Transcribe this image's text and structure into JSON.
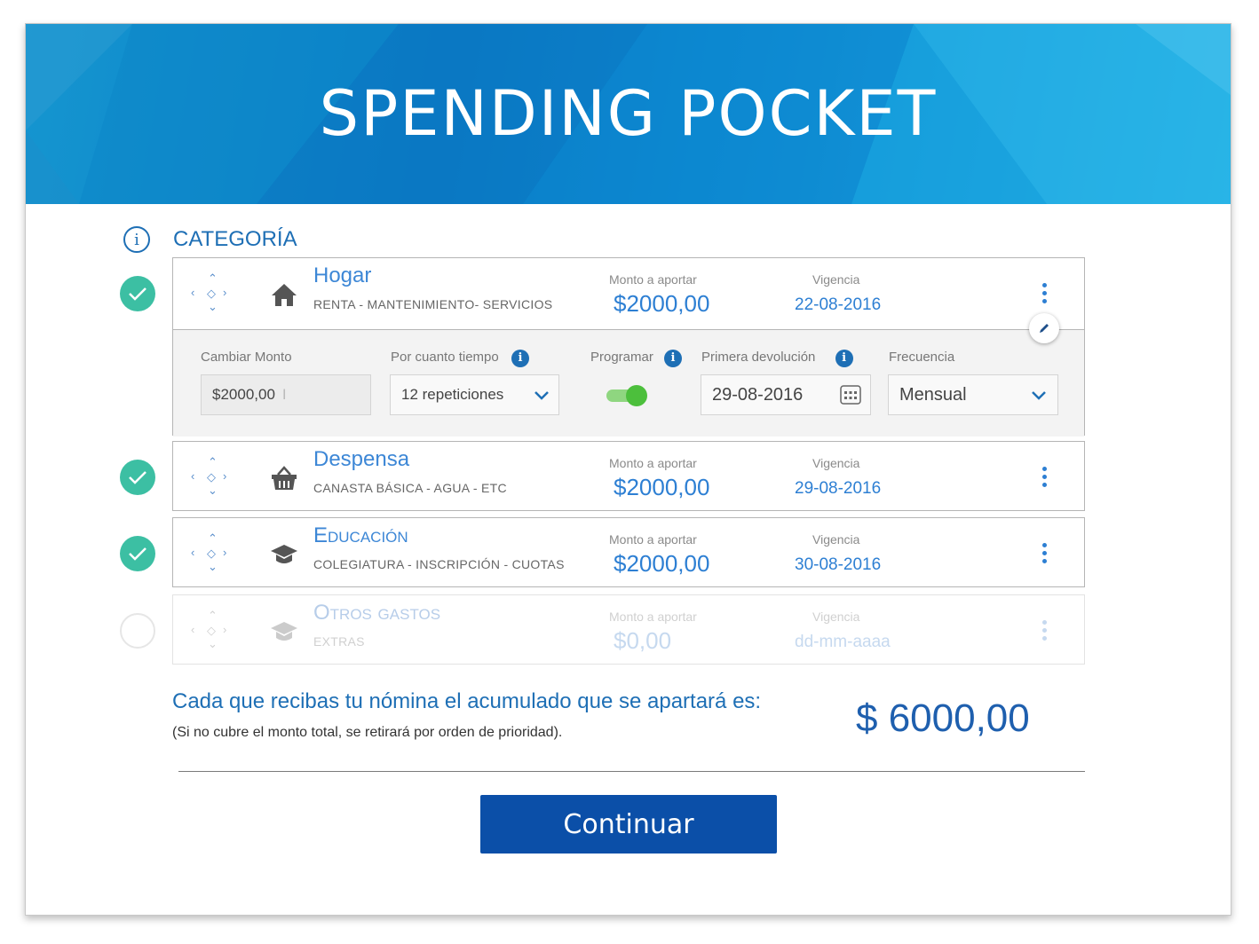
{
  "banner": {
    "title": "SPENDING POCKET"
  },
  "category_header": {
    "info_icon": "info-circle-icon",
    "title": "CATEGORÍA"
  },
  "categories": [
    {
      "title": "Hogar",
      "subtitle": "RENTA - MANTENIMIENTO- SERVICIOS",
      "icon": "house-icon",
      "amount_label": "Monto a aportar",
      "amount": "$2000,00",
      "validity_label": "Vigencia",
      "validity": "22-08-2016",
      "checked": true
    },
    {
      "title": "Despensa",
      "subtitle": "CANASTA BÁSICA - AGUA - ETC",
      "icon": "basket-icon",
      "amount_label": "Monto a aportar",
      "amount": "$2000,00",
      "validity_label": "Vigencia",
      "validity": "29-08-2016",
      "checked": true
    },
    {
      "title": "Educación",
      "subtitle": "COLEGIATURA - INSCRIPCIÓN - CUOTAS",
      "icon": "graduation-cap-icon",
      "amount_label": "Monto a aportar",
      "amount": "$2000,00",
      "validity_label": "Vigencia",
      "validity": "30-08-2016",
      "checked": true
    },
    {
      "title": "Otros gastos",
      "subtitle": "EXTRAS",
      "icon": "graduation-cap-icon",
      "amount_label": "Monto a aportar",
      "amount": "$0,00",
      "validity_label": "Vigencia",
      "validity": "dd-mm-aaaa",
      "checked": false
    }
  ],
  "edit_panel": {
    "change_amount_label": "Cambiar Monto",
    "change_amount_value": "$2000,00",
    "duration_label": "Por cuanto tiempo",
    "duration_value": "12 repeticiones",
    "schedule_label": "Programar",
    "schedule_on": true,
    "first_return_label": "Primera devolución",
    "first_return_value": "29-08-2016",
    "frequency_label": "Frecuencia",
    "frequency_value": "Mensual"
  },
  "summary": {
    "text": "Cada que recibas tu nómina el acumulado que se apartará es:",
    "note": "(Si no cubre el monto total, se retirará por orden de prioridad).",
    "total": "$ 6000,00"
  },
  "continue_label": "Continuar",
  "colors": {
    "primary": "#1e6fb5",
    "accent_blue": "#2d7fd3",
    "check_green": "#3cbfa3",
    "toggle_green": "#4cbf3c",
    "button": "#0b4fa8"
  }
}
